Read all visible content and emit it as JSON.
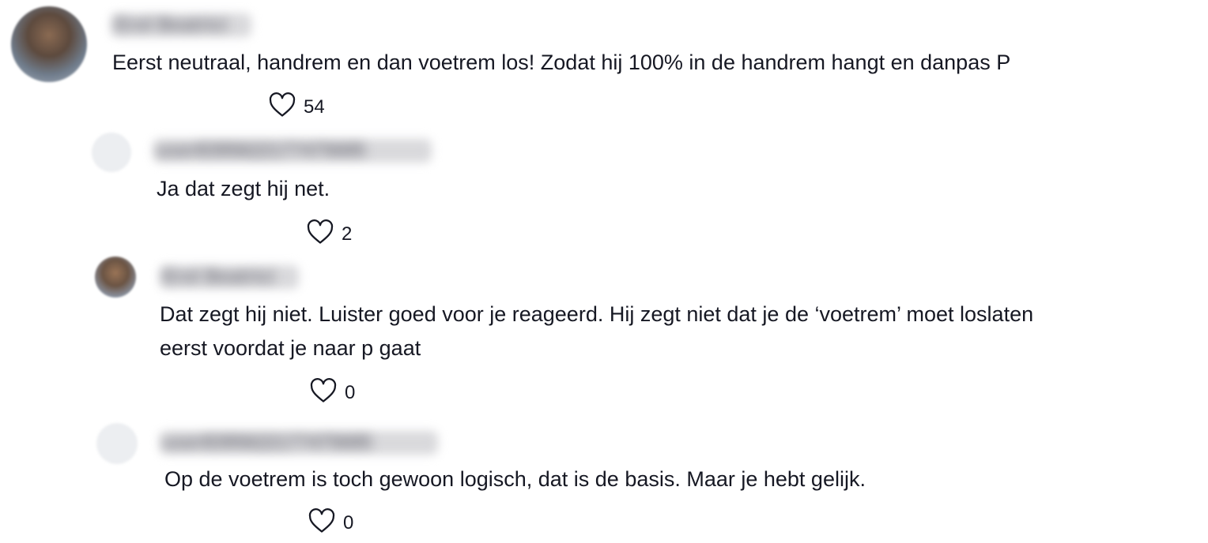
{
  "comments": [
    {
      "username": "Erol Beatrici",
      "text": "Eerst neutraal, handrem en dan voetrem los! Zodat hij 100% in de handrem hangt en danpas P",
      "likes": "54"
    },
    {
      "username": "user8395622177475685",
      "text": "Ja dat zegt hij net.",
      "likes": "2"
    },
    {
      "username": "Erol Beatrici",
      "text_line1": "Dat zegt hij niet. Luister goed voor je reageerd. Hij zegt niet dat je de ‘voetrem’ moet loslaten",
      "text_line2": "eerst voordat je naar p gaat",
      "likes": "0"
    },
    {
      "username": "user8395622177475685",
      "text": "Op de voetrem is toch gewoon logisch, dat is de basis. Maar je hebt gelijk.",
      "likes": "0"
    }
  ],
  "icons": {
    "like": "heart-outline-icon"
  },
  "colors": {
    "text": "#161823",
    "heart_stroke": "#161823"
  }
}
